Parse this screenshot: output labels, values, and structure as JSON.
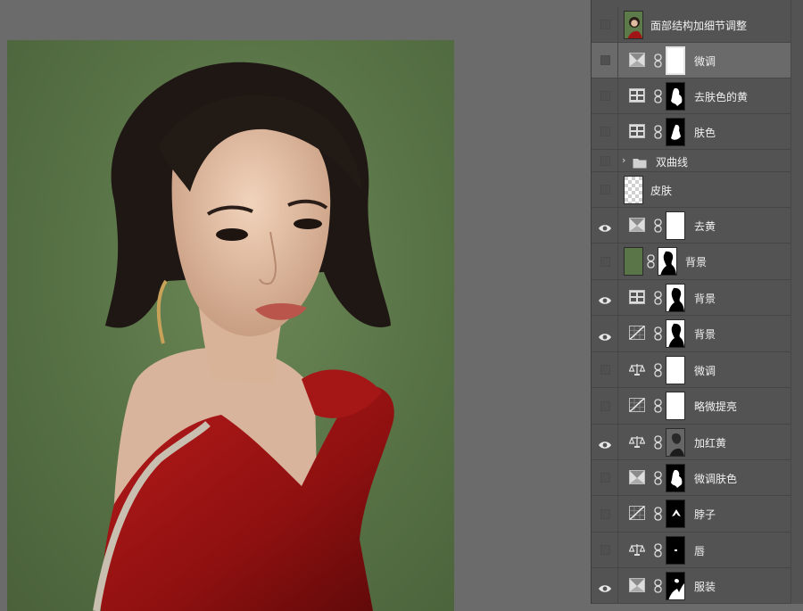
{
  "layers": [
    {
      "name": "面部结构加细节调整",
      "visible": false,
      "kind": "pixel-photo"
    },
    {
      "name": "微调",
      "visible": false,
      "kind": "adjust-hue",
      "mask": "white",
      "selected": true
    },
    {
      "name": "去肤色的黄",
      "visible": false,
      "kind": "adjust-selective",
      "mask": "figure-a"
    },
    {
      "name": "肤色",
      "visible": false,
      "kind": "adjust-selective",
      "mask": "figure-b"
    },
    {
      "name": "双曲线",
      "visible": false,
      "kind": "group"
    },
    {
      "name": "皮肤",
      "visible": false,
      "kind": "pixel-transparent"
    },
    {
      "name": "去黄",
      "visible": true,
      "kind": "adjust-hue",
      "mask": "white"
    },
    {
      "name": "背景",
      "visible": false,
      "kind": "fill-green",
      "mask": "silhouette"
    },
    {
      "name": "背景",
      "visible": true,
      "kind": "adjust-selective",
      "mask": "silhouette"
    },
    {
      "name": "背景",
      "visible": true,
      "kind": "adjust-curves",
      "mask": "silhouette"
    },
    {
      "name": "微调",
      "visible": false,
      "kind": "adjust-balance",
      "mask": "white"
    },
    {
      "name": "略微提亮",
      "visible": false,
      "kind": "adjust-curves",
      "mask": "white"
    },
    {
      "name": "加红黄",
      "visible": true,
      "kind": "adjust-balance",
      "mask": "photo-gray"
    },
    {
      "name": "微调肤色",
      "visible": false,
      "kind": "adjust-hue",
      "mask": "figure-a"
    },
    {
      "name": "脖子",
      "visible": false,
      "kind": "adjust-curves",
      "mask": "neck"
    },
    {
      "name": "唇",
      "visible": false,
      "kind": "adjust-balance",
      "mask": "lip"
    },
    {
      "name": "服装",
      "visible": true,
      "kind": "adjust-hue",
      "mask": "clothes"
    }
  ],
  "colors": {
    "panel_bg": "#535353",
    "selected_row": "#6a6a6a",
    "photo_bg": "#5a7548",
    "dress_red": "#9e1414"
  }
}
